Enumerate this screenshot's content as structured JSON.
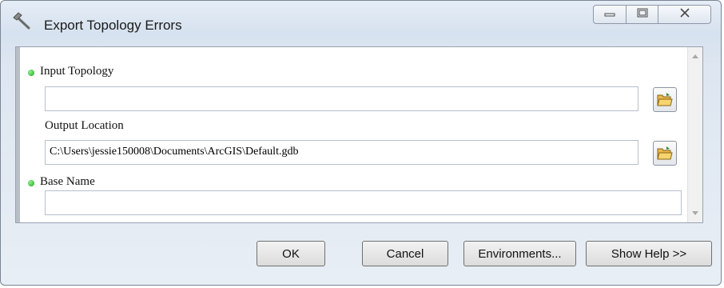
{
  "window": {
    "title": "Export Topology Errors"
  },
  "titlebar_icons": {
    "app": "hammer-icon",
    "minimize": "minimize-icon",
    "maximize": "maximize-icon",
    "close": "close-icon"
  },
  "form": {
    "input_topology": {
      "label": "Input Topology",
      "value": "",
      "required": true
    },
    "output_location": {
      "label": "Output Location",
      "value": "C:\\Users\\jessie150008\\Documents\\ArcGIS\\Default.gdb",
      "required": false
    },
    "base_name": {
      "label": "Base Name",
      "value": "",
      "required": true
    }
  },
  "buttons": {
    "ok": "OK",
    "cancel": "Cancel",
    "environments": "Environments...",
    "show_help": "Show Help >>"
  },
  "colors": {
    "required_dot": "#2db52d"
  }
}
